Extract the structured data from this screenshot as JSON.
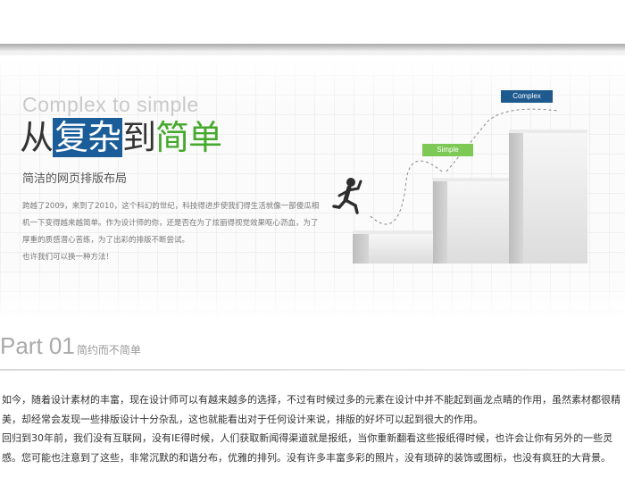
{
  "banner": {
    "english_title": "Complex to simple",
    "title_parts": [
      "从",
      "复杂",
      "到",
      "简单"
    ],
    "subtitle": "简洁的网页排版布局",
    "intro": [
      "跨越了2009，来到了2010，这个科幻的世纪，科技得进步使我们得生活就像一部傻瓜相机一下变得越来越简单。作为设计师的你，还是否在为了炫丽得视觉效果呕心沥血，为了厚重的质感潜心苦练，为了出彩的排版不断尝试。",
      "也许我们可以换一种方法！"
    ],
    "tag_complex": "Complex",
    "tag_simple": "Simple",
    "colors": {
      "highlight": "#1b5d99",
      "green": "#44a92c",
      "complex_tag": "#1f5a8e",
      "simple_tag": "#7ec855"
    }
  },
  "section": {
    "part_label": "Part 01",
    "part_subtitle": "简约而不简单",
    "paragraphs": [
      "如今，随着设计素材的丰富，现在设计师可以有越来越多的选择，不过有时候过多的元素在设计中并不能起到画龙点睛的作用，虽然素材都很精美，却经常会发现一些排版设计十分杂乱，这也就能看出对于任何设计来说，排版的好坏可以起到很大的作用。",
      "回归到30年前，我们没有互联网，没有IE得时候，人们获取新闻得渠道就是报纸，当你重新翻看这些报纸得时候，也许会让你有另外的一些灵感。您可能也注意到了这些，非常沉默的和谐分布，优雅的排列。没有许多丰富多彩的照片，没有琐碎的装饰或图标，也没有疯狂的大背景。"
    ]
  }
}
